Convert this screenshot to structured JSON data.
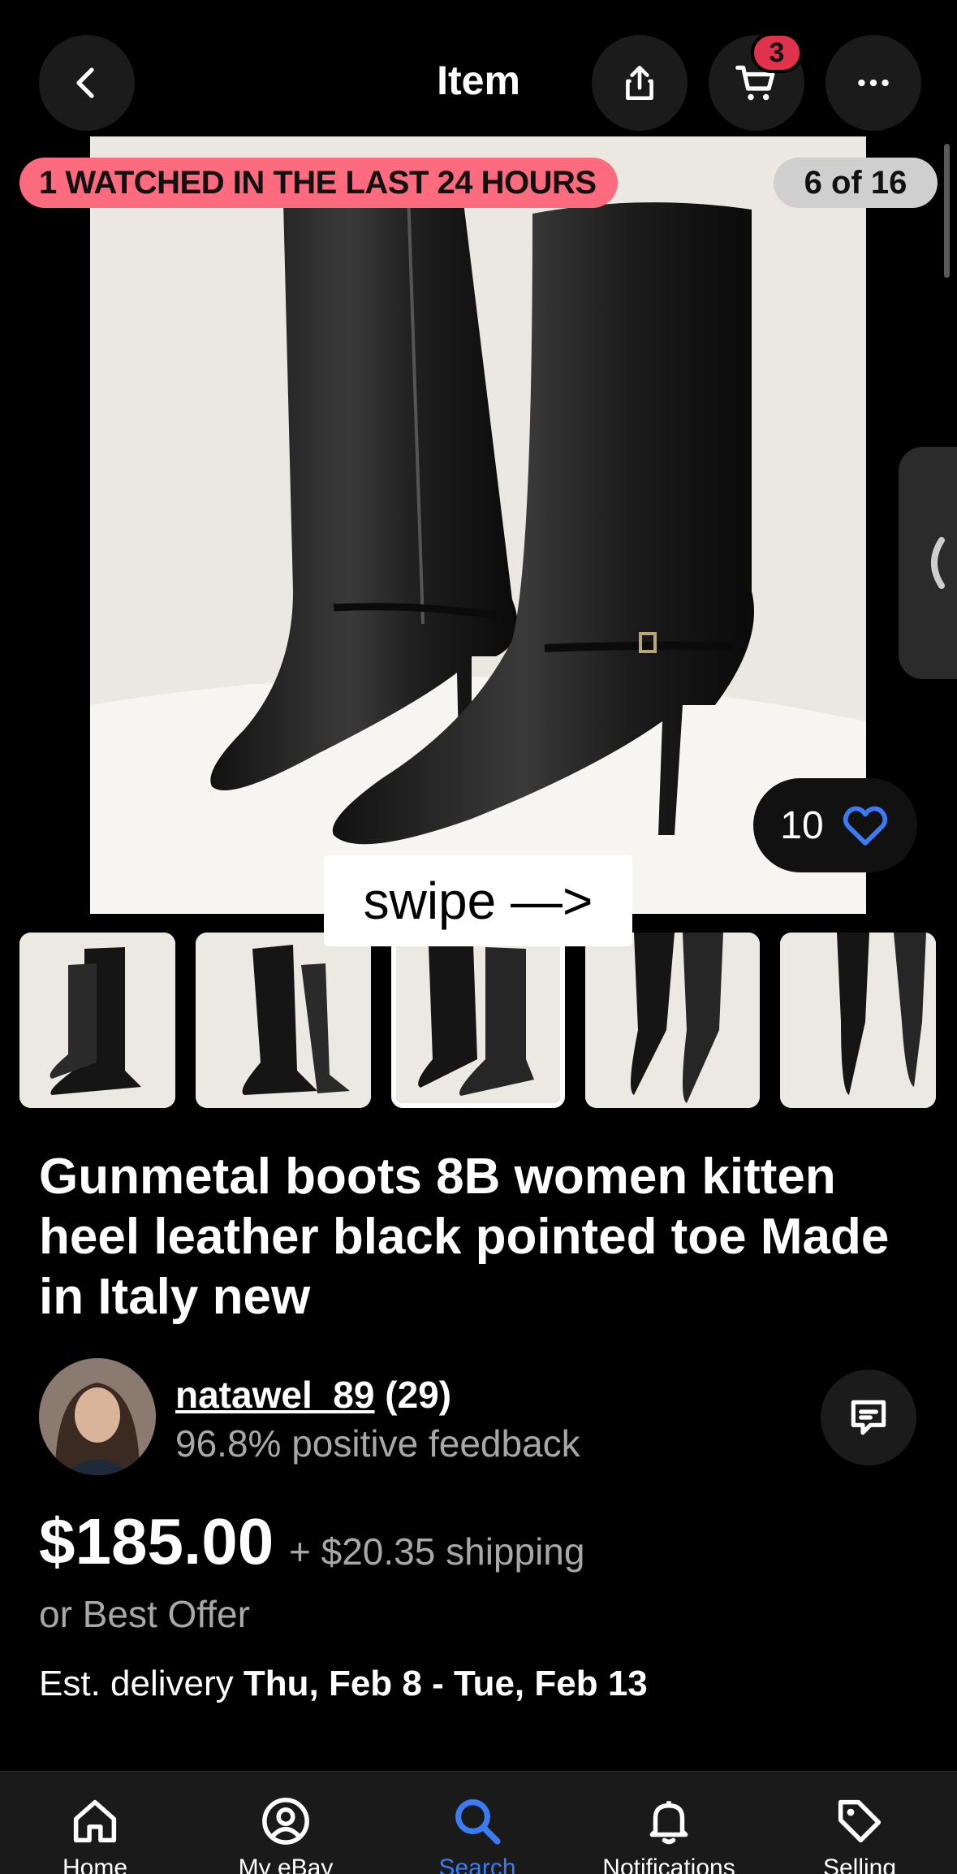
{
  "header": {
    "title": "Item",
    "cart_count": "3"
  },
  "gallery": {
    "watched_banner": "1 WATCHED IN THE LAST 24 HOURS",
    "image_counter": "6 of 16",
    "watch_count": "10",
    "swipe_hint": "swipe —>"
  },
  "listing": {
    "title": "Gunmetal boots 8B women kitten heel leather black pointed toe Made in Italy new",
    "seller": {
      "name": "natawel_89",
      "rating_count": "(29)",
      "feedback": "96.8% positive feedback"
    },
    "price": "$185.00",
    "shipping": "+ $20.35 shipping",
    "best_offer": "or Best Offer",
    "delivery_label": "Est. delivery",
    "delivery_dates": "Thu, Feb 8 - Tue, Feb 13"
  },
  "nav": {
    "items": [
      {
        "label": "Home",
        "icon": "home-icon"
      },
      {
        "label": "My eBay",
        "icon": "profile-icon"
      },
      {
        "label": "Search",
        "icon": "search-icon",
        "active": true
      },
      {
        "label": "Notifications",
        "icon": "bell-icon"
      },
      {
        "label": "Selling",
        "icon": "tag-icon"
      }
    ]
  },
  "colors": {
    "watched_banner": "#ff6b7e",
    "cart_badge": "#e0334b",
    "active_nav": "#3b7cf5",
    "heart": "#3b7cf5"
  }
}
